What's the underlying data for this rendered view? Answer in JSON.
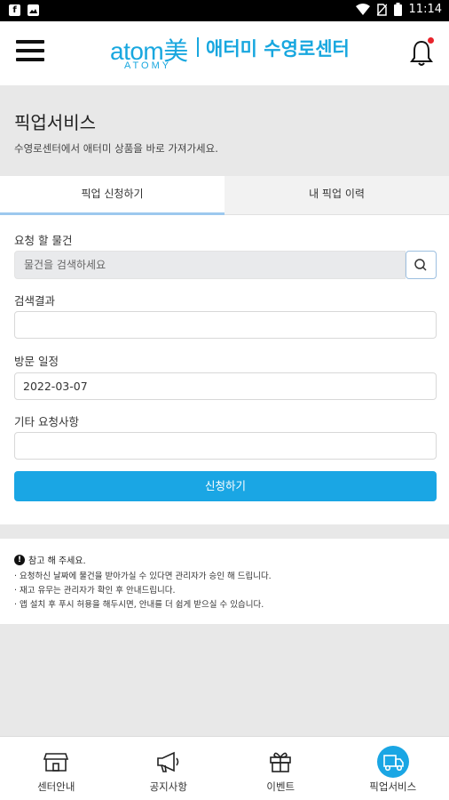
{
  "status_bar": {
    "time": "11:14",
    "icons": [
      "facebook-icon",
      "image-icon",
      "wifi-icon",
      "no-sim-icon",
      "battery-icon"
    ]
  },
  "header": {
    "brand": "atom美",
    "brand_sub": "ATOMY",
    "center_name": "애터미 수영로센터",
    "has_notification": true
  },
  "page": {
    "title": "픽업서비스",
    "subtitle": "수영로센터에서 애터미 상품을 바로 가져가세요."
  },
  "tabs": [
    {
      "label": "픽업 신청하기",
      "active": true
    },
    {
      "label": "내 픽업 이력",
      "active": false
    }
  ],
  "form": {
    "item_label": "요청 할 물건",
    "search_placeholder": "물건을 검색하세요",
    "result_label": "검색결과",
    "result_value": "",
    "date_label": "방문 일정",
    "date_value": "2022-03-07",
    "etc_label": "기타 요청사항",
    "etc_value": "",
    "submit_label": "신청하기"
  },
  "notes": {
    "title": "참고 해 주세요.",
    "lines": [
      "· 요청하신 날짜에 물건을 받아가실 수 있다면 관리자가 승인 해 드립니다.",
      "· 재고 유무는 관리자가 확인 후 안내드립니다.",
      "· 앱 설치 후 푸시 허용을 해두시면, 안내를 더 쉽게 받으실 수 있습니다."
    ]
  },
  "bottom_nav": [
    {
      "label": "센터안내",
      "icon": "store-icon",
      "active": false
    },
    {
      "label": "공지사항",
      "icon": "megaphone-icon",
      "active": false
    },
    {
      "label": "이벤트",
      "icon": "gift-icon",
      "active": false
    },
    {
      "label": "픽업서비스",
      "icon": "truck-icon",
      "active": true
    }
  ],
  "colors": {
    "accent": "#1aa6e4",
    "brand": "#18a7df",
    "background": "#e8e8e8",
    "notification_dot": "#e8232b"
  }
}
